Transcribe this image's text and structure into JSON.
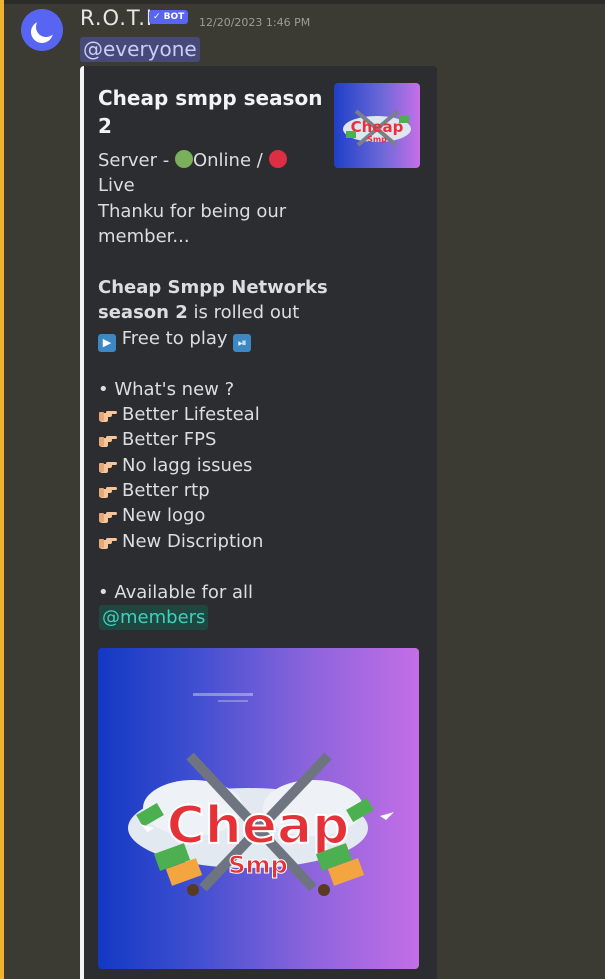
{
  "message": {
    "author": "R.O.T.I",
    "bot_tag": "✓ BOT",
    "timestamp": "12/20/2023 1:46 PM",
    "mention": "@everyone"
  },
  "embed": {
    "title": "Cheap smpp season 2",
    "thumbnail_logo_text": "Cheap Smp",
    "lines": {
      "server_prefix": "Server - ",
      "online": "Online / ",
      "live": "Live",
      "thanks_1": "Thanku for being our",
      "thanks_2": "member...",
      "network_bold_1": "Cheap Smpp Networks",
      "network_bold_2": "season 2",
      "network_rest": " is rolled out",
      "free_to_play": " Free to play ",
      "whats_new": "• What's new ?",
      "features": [
        "Better Lifesteal",
        "Better FPS",
        "No lagg issues",
        "Better rtp",
        "New logo",
        "New Discription"
      ],
      "available": "• Available for all",
      "members_mention": "@members"
    },
    "banner_logo_text": {
      "line1": "Cheap",
      "line2": "Smp"
    }
  },
  "colors": {
    "accent_blurple": "#5865f2",
    "everyone_bg": "#474a77",
    "members_color": "#3fd0c0",
    "highlight_bar": "#f0b232"
  },
  "icons": [
    "avatar-moon-icon",
    "online-dot-icon",
    "live-dot-icon",
    "play-button-icon",
    "play-pause-icon",
    "pointing-hand-icon"
  ]
}
